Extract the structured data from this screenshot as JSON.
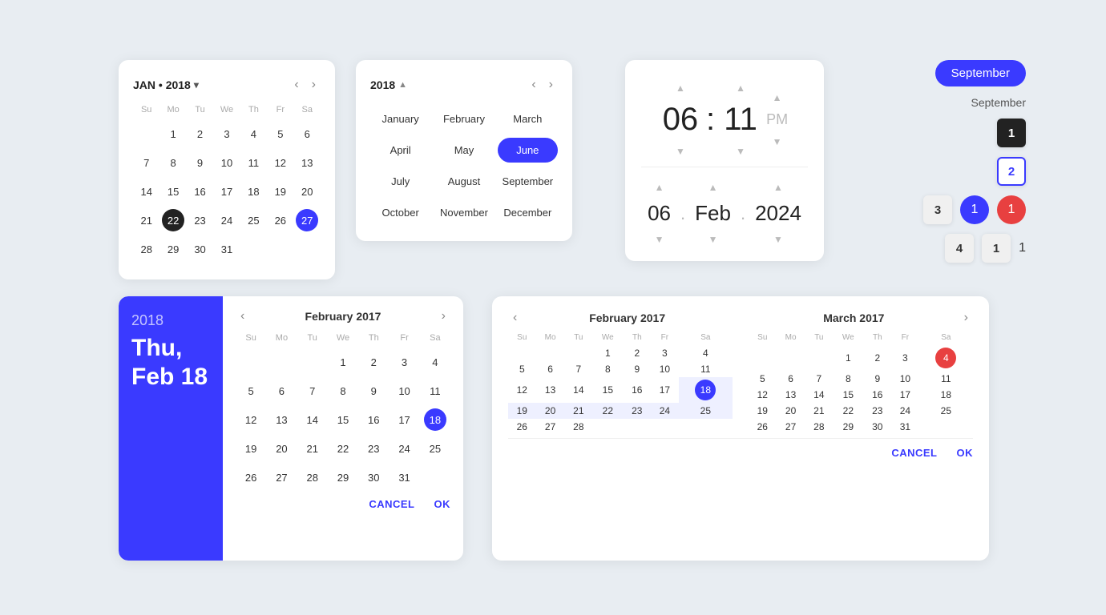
{
  "cal1": {
    "title": "JAN • 2018",
    "weekdays": [
      "Su",
      "Mo",
      "Tu",
      "We",
      "Th",
      "Fr",
      "Sa"
    ],
    "rows": [
      [
        null,
        1,
        2,
        3,
        4,
        5,
        6
      ],
      [
        7,
        8,
        9,
        10,
        11,
        12,
        13
      ],
      [
        14,
        15,
        16,
        17,
        18,
        19,
        20
      ],
      [
        21,
        22,
        23,
        24,
        25,
        26,
        27
      ],
      [
        28,
        29,
        30,
        31,
        null,
        null,
        null
      ]
    ],
    "today": 22,
    "selected": 27
  },
  "cal2": {
    "year": "2018",
    "months": [
      "January",
      "February",
      "March",
      "April",
      "May",
      "June",
      "July",
      "August",
      "September",
      "October",
      "November",
      "December"
    ],
    "selected": "June"
  },
  "timepicker": {
    "hour": "06",
    "minute": "11",
    "ampm": "PM",
    "day": "06",
    "month": "Feb",
    "year": "2024"
  },
  "badges": {
    "pill_label": "September",
    "month_label": "September",
    "rows": [
      {
        "box_label": "1",
        "box_type": "dark"
      },
      {
        "box_label": "2",
        "box_type": "blue"
      },
      {
        "circle_blue": "1",
        "circle_red": "1"
      },
      {
        "box_label": "1",
        "num": "1"
      }
    ],
    "row_labels": [
      "1",
      "2",
      "3",
      "4"
    ]
  },
  "datepicker_side": {
    "year": "2018",
    "date": "Thu, Feb 18",
    "month_title": "February 2017",
    "weekdays": [
      "Su",
      "Mo",
      "Tu",
      "We",
      "Th",
      "Fr",
      "Sa"
    ],
    "rows": [
      [
        null,
        null,
        null,
        1,
        2,
        3,
        4
      ],
      [
        5,
        6,
        7,
        8,
        9,
        10,
        11
      ],
      [
        12,
        13,
        14,
        15,
        16,
        17,
        18
      ],
      [
        19,
        20,
        21,
        22,
        23,
        24,
        25
      ],
      [
        26,
        27,
        28,
        29,
        30,
        31,
        null
      ]
    ],
    "selected": 18,
    "cancel_label": "CANCEL",
    "ok_label": "OK"
  },
  "daterange": {
    "feb_title": "February 2017",
    "mar_title": "March 2017",
    "weekdays": [
      "Su",
      "Mo",
      "Tu",
      "We",
      "Th",
      "Fr",
      "Sa"
    ],
    "feb_rows": [
      [
        null,
        null,
        null,
        1,
        2,
        3,
        4
      ],
      [
        5,
        6,
        7,
        8,
        9,
        10,
        11
      ],
      [
        12,
        13,
        14,
        15,
        16,
        17,
        18
      ],
      [
        19,
        20,
        21,
        22,
        23,
        24,
        25
      ],
      [
        26,
        27,
        28,
        null,
        null,
        null,
        null
      ]
    ],
    "mar_rows": [
      [
        null,
        null,
        null,
        1,
        2,
        3,
        4
      ],
      [
        5,
        6,
        7,
        8,
        9,
        10,
        11
      ],
      [
        12,
        13,
        14,
        15,
        16,
        17,
        18
      ],
      [
        19,
        20,
        21,
        22,
        23,
        24,
        25
      ],
      [
        26,
        27,
        28,
        29,
        30,
        31,
        null
      ]
    ],
    "feb_selected": 18,
    "mar_selected": 4,
    "range_start_feb": 19,
    "range_end_feb": 25,
    "cancel_label": "CANCEL",
    "ok_label": "OK"
  }
}
